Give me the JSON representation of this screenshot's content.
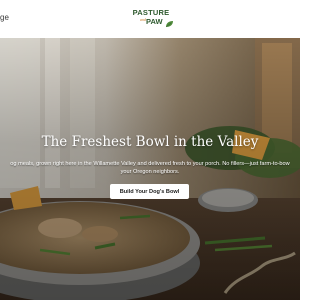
{
  "header": {
    "nav_link": "ge",
    "logo": {
      "line1": "PASTURE",
      "and": "and",
      "line2": "PAW"
    }
  },
  "hero": {
    "title": "The Freshest Bowl in the Valley",
    "subtitle_line1": "og meals, grown right here in the Willamette Valley and delivered fresh to your porch. No fillers—just farm-to-bow",
    "subtitle_line2": "your Oregon neighbors.",
    "cta_label": "Build Your Dog's Bowl"
  },
  "colors": {
    "brand_green": "#2e5a2e",
    "brand_orange": "#c97a2a",
    "button_bg": "#ffffff",
    "title_text": "#ffffff"
  },
  "icons": {
    "logo_leaf": "leaf-icon"
  }
}
